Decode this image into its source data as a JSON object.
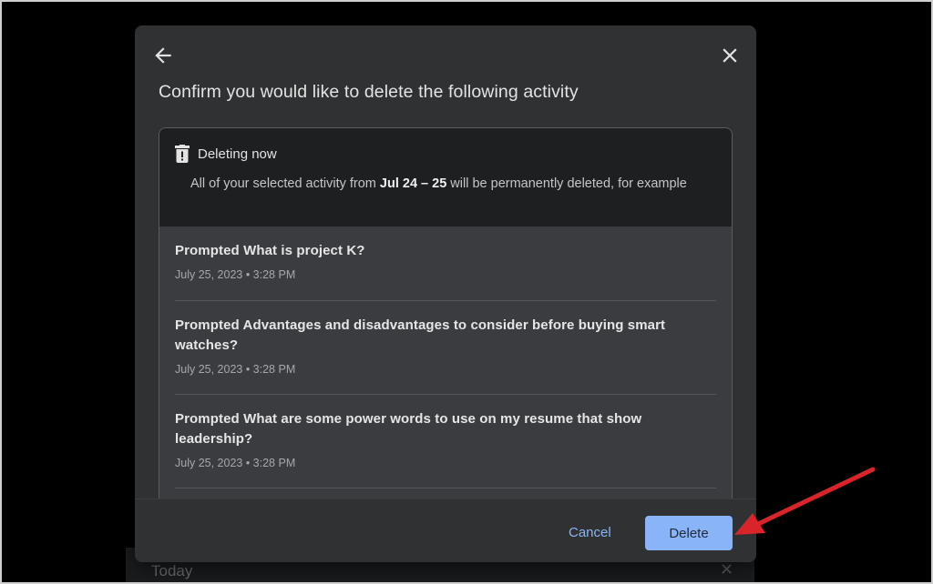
{
  "background": {
    "today_label": "Today",
    "close_glyph": "✕"
  },
  "dialog": {
    "title": "Confirm you would like to delete the following activity",
    "back_icon": "arrow-left-icon",
    "close_icon": "close-icon",
    "notice": {
      "heading": "Deleting now",
      "desc_prefix": "All of your selected activity from ",
      "desc_range": "Jul 24 – 25",
      "desc_suffix": " will be permanently deleted, for example"
    },
    "items": [
      {
        "title": "Prompted What is project K?",
        "time": "July 25, 2023 • 3:28 PM"
      },
      {
        "title": "Prompted Advantages and disadvantages to consider before buying smart watches?",
        "time": "July 25, 2023 • 3:28 PM"
      },
      {
        "title": "Prompted What are some power words to use on my resume that show leadership?",
        "time": "July 25, 2023 • 3:28 PM"
      }
    ],
    "cancel_label": "Cancel",
    "delete_label": "Delete"
  },
  "colors": {
    "accent": "#8ab4f8",
    "annotation_arrow": "#d9252a"
  }
}
